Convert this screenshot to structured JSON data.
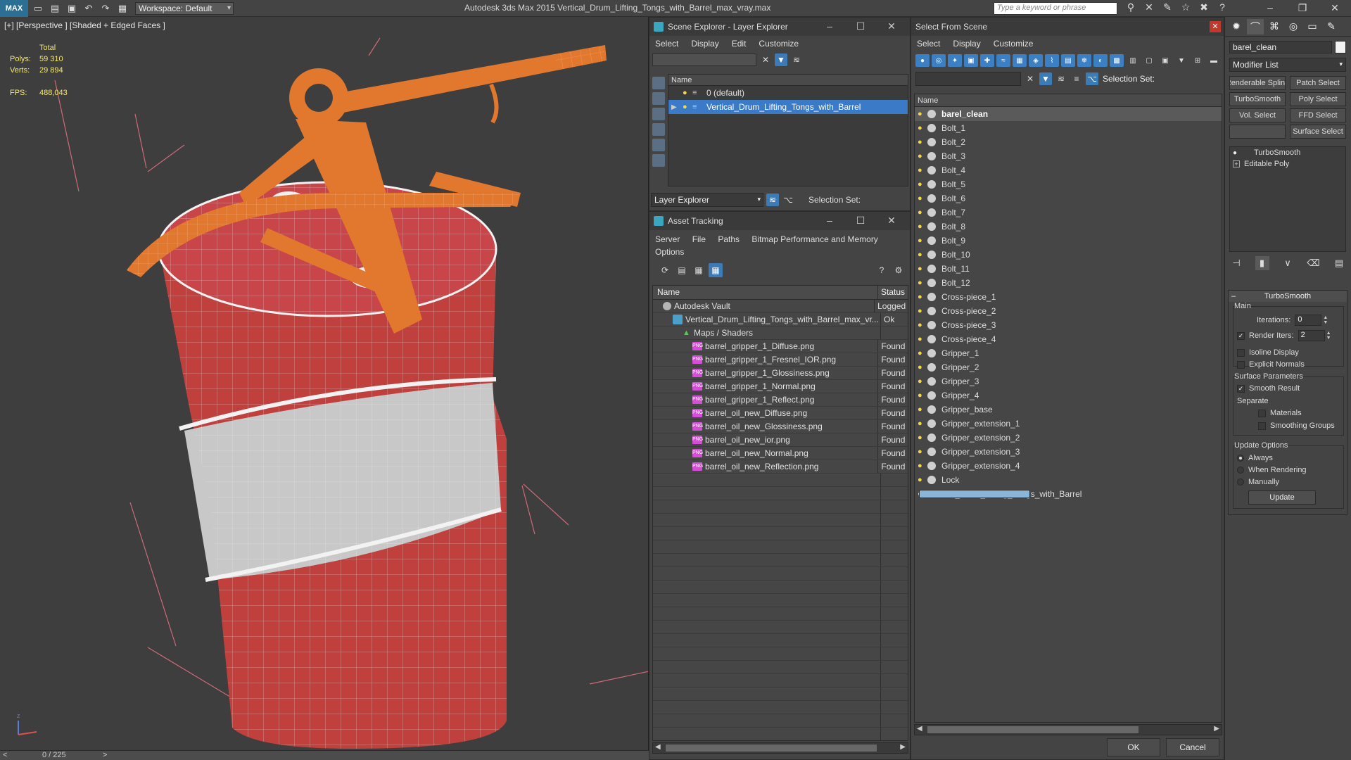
{
  "titlebar": {
    "app_logo": "MAX",
    "workspace": "Workspace: Default",
    "title": "Autodesk 3ds Max  2015    Vertical_Drum_Lifting_Tongs_with_Barrel_max_vray.max",
    "search_placeholder": "Type a keyword or phrase",
    "icons": [
      "new-file-icon",
      "open-file-icon",
      "save-icon",
      "undo-icon",
      "redo-icon",
      "project-icon"
    ]
  },
  "viewport": {
    "label": "[+] [Perspective ] [Shaded + Edged Faces ]",
    "stats": {
      "total_label": "Total",
      "polys_label": "Polys:",
      "polys_value": "59 310",
      "verts_label": "Verts:",
      "verts_value": "29 894",
      "fps_label": "FPS:",
      "fps_value": "488,043"
    },
    "colors": {
      "barrel_red": "#c0403d",
      "tongs_orange": "#e2782e",
      "band_white": "#c8c8c8"
    }
  },
  "timebar": {
    "frame": "0 / 225",
    "left_arrow": "<",
    "right_arrow": ">"
  },
  "scene_explorer": {
    "title": "Scene Explorer - Layer Explorer",
    "menu": [
      "Select",
      "Display",
      "Edit",
      "Customize"
    ],
    "column_name": "Name",
    "rows": [
      {
        "label": "0 (default)",
        "selected": false
      },
      {
        "label": "Vertical_Drum_Lifting_Tongs_with_Barrel",
        "selected": true
      }
    ],
    "footer_dropdown": "Layer Explorer",
    "selection_set_label": "Selection Set:"
  },
  "asset_tracking": {
    "title": "Asset Tracking",
    "menu": [
      "Server",
      "File",
      "Paths",
      "Bitmap Performance and Memory"
    ],
    "menu2": "Options",
    "columns": {
      "name": "Name",
      "status": "Status"
    },
    "rows": [
      {
        "name": "Autodesk Vault",
        "status": "Logged",
        "indent": 1,
        "icon": "vault"
      },
      {
        "name": "Vertical_Drum_Lifting_Tongs_with_Barrel_max_vr...",
        "status": "Ok",
        "indent": 2,
        "icon": "file"
      },
      {
        "name": "Maps / Shaders",
        "status": "",
        "indent": 3,
        "icon": "maps"
      },
      {
        "name": "barrel_gripper_1_Diffuse.png",
        "status": "Found",
        "indent": 4,
        "icon": "png"
      },
      {
        "name": "barrel_gripper_1_Fresnel_IOR.png",
        "status": "Found",
        "indent": 4,
        "icon": "png"
      },
      {
        "name": "barrel_gripper_1_Glossiness.png",
        "status": "Found",
        "indent": 4,
        "icon": "png"
      },
      {
        "name": "barrel_gripper_1_Normal.png",
        "status": "Found",
        "indent": 4,
        "icon": "png"
      },
      {
        "name": "barrel_gripper_1_Reflect.png",
        "status": "Found",
        "indent": 4,
        "icon": "png"
      },
      {
        "name": "barrel_oil_new_Diffuse.png",
        "status": "Found",
        "indent": 4,
        "icon": "png"
      },
      {
        "name": "barrel_oil_new_Glossiness.png",
        "status": "Found",
        "indent": 4,
        "icon": "png"
      },
      {
        "name": "barrel_oil_new_ior.png",
        "status": "Found",
        "indent": 4,
        "icon": "png"
      },
      {
        "name": "barrel_oil_new_Normal.png",
        "status": "Found",
        "indent": 4,
        "icon": "png"
      },
      {
        "name": "barrel_oil_new_Reflection.png",
        "status": "Found",
        "indent": 4,
        "icon": "png"
      }
    ]
  },
  "select_from_scene": {
    "title": "Select From Scene",
    "menu": [
      "Select",
      "Display",
      "Customize"
    ],
    "selection_set_label": "Selection Set:",
    "column_name": "Name",
    "objects": [
      "barel_clean",
      "Bolt_1",
      "Bolt_2",
      "Bolt_3",
      "Bolt_4",
      "Bolt_5",
      "Bolt_6",
      "Bolt_7",
      "Bolt_8",
      "Bolt_9",
      "Bolt_10",
      "Bolt_11",
      "Bolt_12",
      "Cross-piece_1",
      "Cross-piece_2",
      "Cross-piece_3",
      "Cross-piece_4",
      "Gripper_1",
      "Gripper_2",
      "Gripper_3",
      "Gripper_4",
      "Gripper_base",
      "Gripper_extension_1",
      "Gripper_extension_2",
      "Gripper_extension_3",
      "Gripper_extension_4",
      "Lock",
      "Vertical_Drum_Lifting_Tongs_with_Barrel"
    ],
    "selected_index": 0,
    "ok_label": "OK",
    "cancel_label": "Cancel"
  },
  "command_panel": {
    "object_name": "barel_clean",
    "modifier_list": "Modifier List",
    "mod_buttons": [
      "Renderable Spline",
      "Patch Select",
      "TurboSmooth",
      "Poly Select",
      "Vol. Select",
      "FFD Select",
      "",
      "Surface Select"
    ],
    "stack": [
      "TurboSmooth",
      "Editable Poly"
    ],
    "turbosmooth": {
      "title": "TurboSmooth",
      "main_label": "Main",
      "iterations_label": "Iterations:",
      "iterations_value": "0",
      "render_iters_label": "Render Iters:",
      "render_iters_value": "2",
      "render_iters_checked": true,
      "isoline_label": "Isoline Display",
      "explicit_normals_label": "Explicit Normals",
      "surface_params_label": "Surface Parameters",
      "smooth_result_label": "Smooth Result",
      "separate_label": "Separate",
      "materials_label": "Materials",
      "smoothing_groups_label": "Smoothing Groups",
      "update_options_label": "Update Options",
      "always_label": "Always",
      "when_rendering_label": "When Rendering",
      "manually_label": "Manually",
      "update_label": "Update"
    }
  }
}
